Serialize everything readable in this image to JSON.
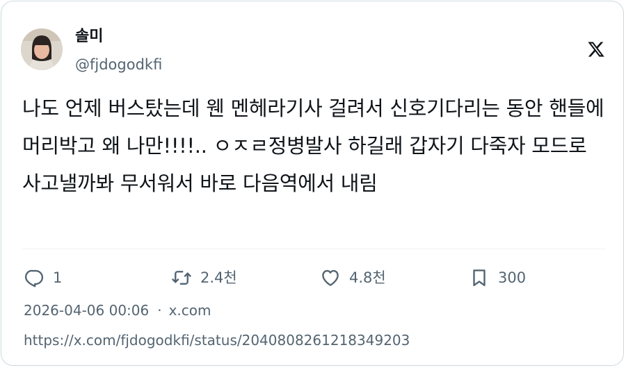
{
  "author": {
    "display_name": "솔미",
    "handle": "@fjdogodkfi"
  },
  "brand_icon": "x-logo-icon",
  "tweet": {
    "text": "나도 언제 버스탔는데 웬 멘헤라기사 걸려서 신호기다리는 동안 핸들에 머리박고 왜 나만!!!!.. ㅇㅈㄹ정병발사 하길래 갑자기 다죽자 모드로 사고낼까봐 무서워서 바로 다음역에서 내림"
  },
  "actions": {
    "reply": {
      "icon": "reply-icon",
      "count": "1"
    },
    "retweet": {
      "icon": "retweet-icon",
      "count": "2.4천"
    },
    "like": {
      "icon": "heart-icon",
      "count": "4.8천"
    },
    "bookmark": {
      "icon": "bookmark-icon",
      "count": "300"
    }
  },
  "meta": {
    "timestamp": "2026-04-06 00:06",
    "separator": "·",
    "source": "x.com"
  },
  "url": "https://x.com/fjdogodkfi/status/2040808261218349203",
  "colors": {
    "text_primary": "#0f1419",
    "text_secondary": "#536471",
    "border": "#cfd9de"
  }
}
